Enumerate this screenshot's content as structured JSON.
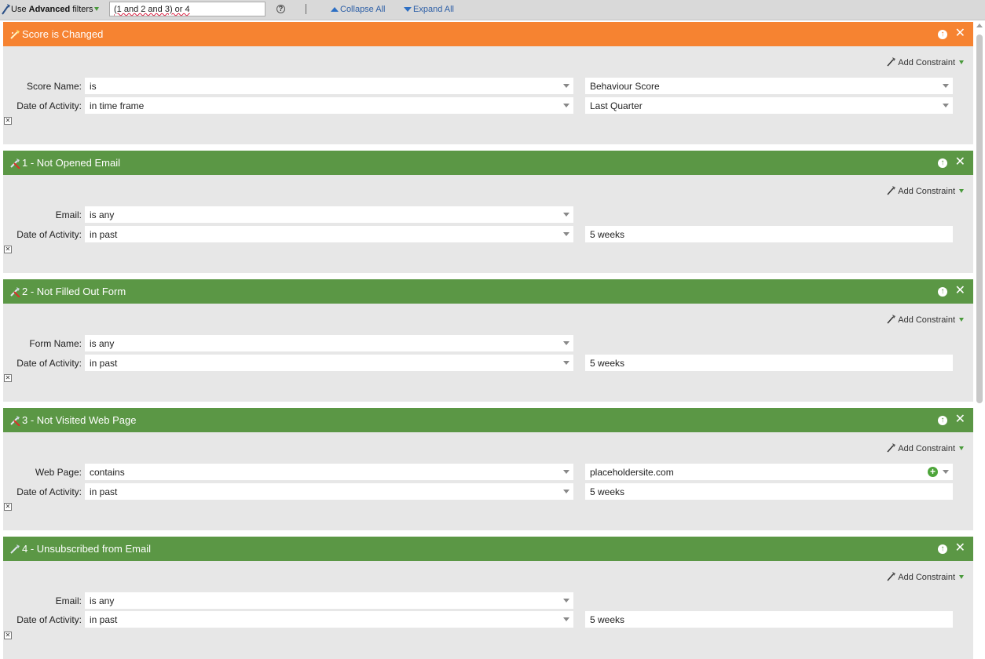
{
  "toolbar": {
    "use_prefix": "Use ",
    "use_bold": "Advanced",
    "use_suffix": " filters",
    "logic_value": "(1 and 2 and 3) or 4",
    "help_glyph": "?",
    "separator": "|",
    "collapse_label": "Collapse All",
    "expand_label": "Expand All"
  },
  "common": {
    "add_constraint_label": "Add Constraint",
    "move_up_glyph": "↑",
    "close_glyph": "✕",
    "remove_glyph": "✕"
  },
  "filters": [
    {
      "title": "Score is Changed",
      "header_color": "#f68331",
      "icon": "wand-icon",
      "rows": [
        {
          "label": "Score Name:",
          "operator": "is",
          "value": "Behaviour Score"
        },
        {
          "label": "Date of Activity:",
          "operator": "in time frame",
          "value": "Last Quarter"
        }
      ]
    },
    {
      "title": "1 - Not Opened Email",
      "header_color": "#5b9745",
      "icon": "negated-filter-icon",
      "rows": [
        {
          "label": "Email:",
          "operator": "is any",
          "value": ""
        },
        {
          "label": "Date of Activity:",
          "operator": "in past",
          "value": "5 weeks"
        }
      ]
    },
    {
      "title": "2 - Not Filled Out Form",
      "header_color": "#5b9745",
      "icon": "negated-filter-icon",
      "rows": [
        {
          "label": "Form Name:",
          "operator": "is any",
          "value": ""
        },
        {
          "label": "Date of Activity:",
          "operator": "in past",
          "value": "5 weeks"
        }
      ]
    },
    {
      "title": "3 - Not Visited Web Page",
      "header_color": "#5b9745",
      "icon": "negated-filter-icon",
      "rows": [
        {
          "label": "Web Page:",
          "operator": "contains",
          "value": "placeholdersite.com"
        },
        {
          "label": "Date of Activity:",
          "operator": "in past",
          "value": "5 weeks"
        }
      ]
    },
    {
      "title": "4 - Unsubscribed from Email",
      "header_color": "#5b9745",
      "icon": "filter-icon",
      "rows": [
        {
          "label": "Email:",
          "operator": "is any",
          "value": ""
        },
        {
          "label": "Date of Activity:",
          "operator": "in past",
          "value": "5 weeks"
        }
      ]
    }
  ],
  "colors": {
    "toolbar_bg": "#d9d9d9",
    "panel_bg": "#e7e7e7",
    "orange_header": "#f68331",
    "green_header": "#5b9745",
    "link_blue": "#2d5fa6",
    "plus_green": "#4da53a"
  }
}
